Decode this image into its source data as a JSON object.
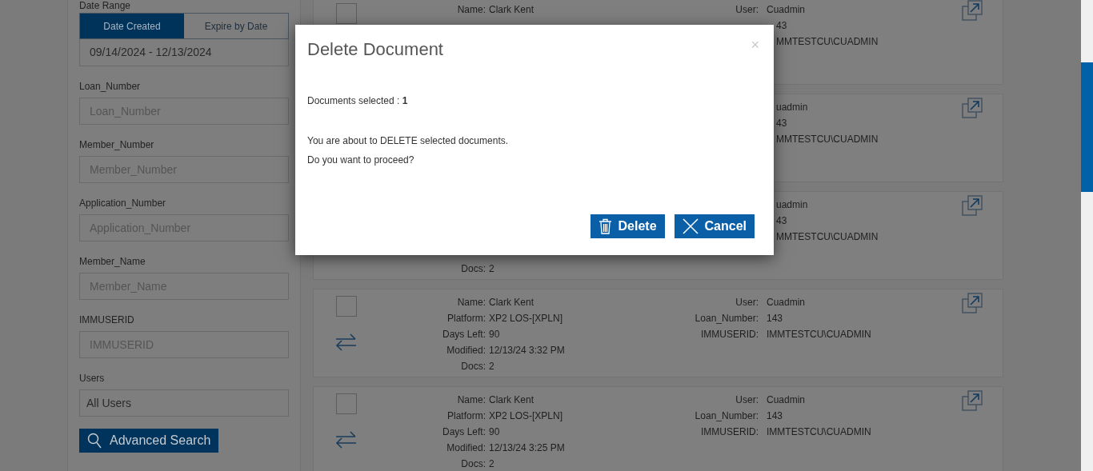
{
  "sidebar": {
    "date_range": {
      "label": "Date Range",
      "tabs": [
        {
          "label": "Date Created",
          "selected": true
        },
        {
          "label": "Expire by Date",
          "selected": false
        }
      ],
      "value": "09/14/2024 - 12/13/2024"
    },
    "fields": [
      {
        "label": "Loan_Number",
        "placeholder": "Loan_Number"
      },
      {
        "label": "Member_Number",
        "placeholder": "Member_Number"
      },
      {
        "label": "Application_Number",
        "placeholder": "Application_Number"
      },
      {
        "label": "Member_Name",
        "placeholder": "Member_Name"
      },
      {
        "label": "IMMUSERID",
        "placeholder": "IMMUSERID"
      },
      {
        "label": "Users",
        "value": "All Users"
      }
    ],
    "search_button": "Advanced Search"
  },
  "cards": [
    {
      "kind": "top",
      "checked": false,
      "left_fields": [
        {
          "label": "Name:",
          "value": "Clark Kent"
        }
      ],
      "right_fields": [
        {
          "label": "User:",
          "value": "Cuadmin"
        },
        {
          "value": "43"
        },
        {
          "value": "MMTESTCU\\CUADMIN"
        }
      ]
    },
    {
      "kind": "covered",
      "right_fields": [
        {
          "value": "uadmin"
        },
        {
          "value": "43"
        },
        {
          "value": "MMTESTCU\\CUADMIN"
        }
      ]
    },
    {
      "kind": "covered",
      "bottom_field": {
        "label": "Docs:",
        "value": "2"
      },
      "right_fields": [
        {
          "value": "uadmin"
        },
        {
          "value": "43"
        },
        {
          "value": "MMTESTCU\\CUADMIN"
        }
      ]
    },
    {
      "kind": "full",
      "checked": false,
      "left_fields": [
        {
          "label": "Name:",
          "value": "Clark Kent"
        },
        {
          "label": "Platform:",
          "value": "XP2 LOS-[XPLN]"
        },
        {
          "label": "Days Left:",
          "value": "90"
        },
        {
          "label": "Modified:",
          "value": "12/13/24 3:32 PM"
        },
        {
          "label": "Docs:",
          "value": "2"
        }
      ],
      "right_fields": [
        {
          "label": "User:",
          "value": "Cuadmin"
        },
        {
          "label": "Loan_Number:",
          "value": "143"
        },
        {
          "label": "IMMUSERID:",
          "value": "IMMTESTCU\\CUADMIN"
        }
      ]
    },
    {
      "kind": "full",
      "checked": false,
      "left_fields": [
        {
          "label": "Name:",
          "value": "Clark Kent"
        },
        {
          "label": "Platform:",
          "value": "XP2 LOS-[XPLN]"
        },
        {
          "label": "Days Left:",
          "value": "90"
        },
        {
          "label": "Modified:",
          "value": "12/13/24 3:25 PM"
        },
        {
          "label": "Docs:",
          "value": "2"
        }
      ],
      "right_fields": [
        {
          "label": "User:",
          "value": "Cuadmin"
        },
        {
          "label": "Loan_Number:",
          "value": "143"
        },
        {
          "label": "IMMUSERID:",
          "value": "IMMTESTCU\\CUADMIN"
        }
      ]
    }
  ],
  "dialog": {
    "title": "Delete Document",
    "close": "×",
    "selected_text": "Documents selected : **1**",
    "message": [
      "You are about to DELETE selected documents.",
      "Do you want to proceed?"
    ],
    "buttons": [
      {
        "kind": "delete",
        "label": "Delete"
      },
      {
        "kind": "cancel",
        "label": "Cancel"
      }
    ]
  }
}
